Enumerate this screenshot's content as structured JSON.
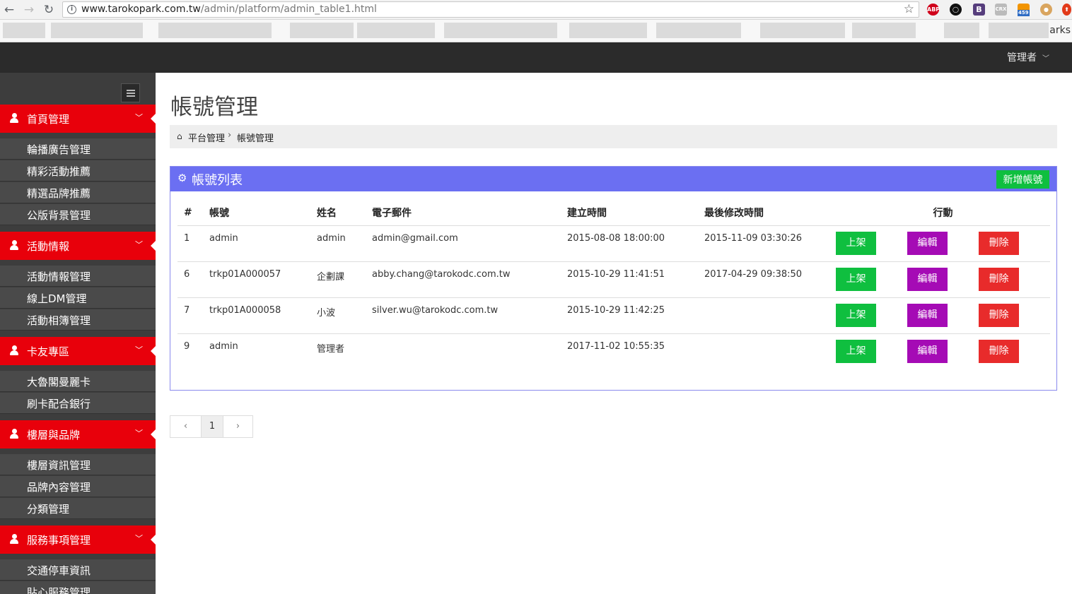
{
  "browser": {
    "url_host": "www.tarokopark.com.tw",
    "url_path": "/admin/platform/admin_table1.html",
    "bookmarks_more": "arks",
    "ext_badge": "459"
  },
  "topbar": {
    "user_label": "管理者"
  },
  "sidebar": {
    "sections": [
      {
        "label": "首頁管理",
        "items": [
          "輪播廣告管理",
          "精彩活動推薦",
          "精選品牌推薦",
          "公版背景管理"
        ]
      },
      {
        "label": "活動情報",
        "items": [
          "活動情報管理",
          "線上DM管理",
          "活動相簿管理"
        ]
      },
      {
        "label": "卡友專區",
        "items": [
          "大魯閣曼麗卡",
          "刷卡配合銀行"
        ]
      },
      {
        "label": "樓層與品牌",
        "items": [
          "樓層資訊管理",
          "品牌內容管理",
          "分類管理"
        ]
      },
      {
        "label": "服務事項管理",
        "items": [
          "交通停車資訊",
          "貼心服務管理"
        ]
      }
    ]
  },
  "page": {
    "title": "帳號管理"
  },
  "breadcrumb": {
    "parent": "平台管理",
    "current": "帳號管理"
  },
  "panel": {
    "title": "帳號列表",
    "add_button": "新增帳號"
  },
  "table": {
    "headers": [
      "#",
      "帳號",
      "姓名",
      "電子郵件",
      "建立時間",
      "最後修改時間",
      "行動"
    ],
    "rows": [
      {
        "id": "1",
        "account": "admin",
        "name": "admin",
        "email": "admin@gmail.com",
        "created": "2015-08-08 18:00:00",
        "modified": "2015-11-09 03:30:26"
      },
      {
        "id": "6",
        "account": "trkp01A000057",
        "name": "企劃課",
        "email": "abby.chang@tarokodc.com.tw",
        "created": "2015-10-29 11:41:51",
        "modified": "2017-04-29 09:38:50"
      },
      {
        "id": "7",
        "account": "trkp01A000058",
        "name": "小波",
        "email": "silver.wu@tarokodc.com.tw",
        "created": "2015-10-29 11:42:25",
        "modified": ""
      },
      {
        "id": "9",
        "account": "admin",
        "name": "管理者",
        "email": "",
        "created": "2017-11-02 10:55:35",
        "modified": ""
      }
    ],
    "actions": {
      "publish": "上架",
      "edit": "編輯",
      "delete": "刪除"
    }
  },
  "pagination": {
    "prev": "‹",
    "current": "1",
    "next": "›"
  },
  "colors": {
    "topbar": "#2b2b2b",
    "sidebar": "#3d3d3d",
    "section": "#e8000b",
    "panel_head": "#6b6ff2",
    "green": "#0fbf3f",
    "purple": "#a50bb5",
    "red": "#e82b2b"
  }
}
